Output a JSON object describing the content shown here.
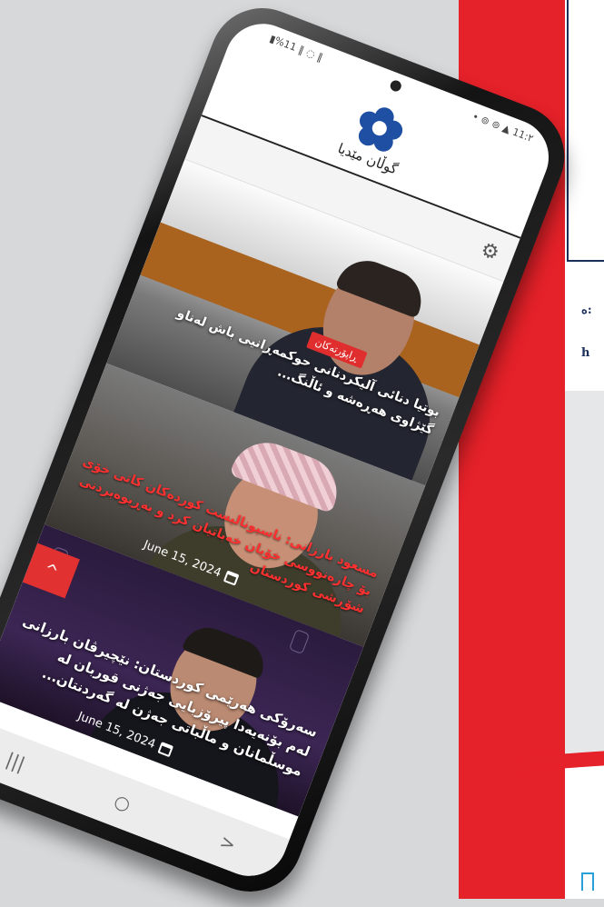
{
  "status_bar": {
    "left": "▮%11 ‖ ◌ ‖",
    "right": "• ⊚ ⊚ ▲ 11:٢"
  },
  "header": {
    "site_title": "گوڵان مێدیا"
  },
  "toolbar": {
    "settings_icon": "gear-icon"
  },
  "articles": [
    {
      "category": "ڕاپۆرتەکان",
      "headline": "بوتیا دنائی آلیکردنانی حوکمەڕانیی باش لەناو گێژاوی هەڕەشە و ئاڵنگ...",
      "date": ""
    },
    {
      "category": "",
      "headline": "مسعود بارزانی: ناسیونالیست کوردەکان کاتی خۆی بۆ چارەنووسی خۆیان خەباتیان کرد و بەڕیوەبردنی شۆڕشی کوردستان",
      "date": "June 15, 2024"
    },
    {
      "category": "",
      "headline": "سەرۆکی هەرێمی کوردستان: نێچیرڤان بارزانی لەم بۆنەیەدا پیرۆزبایی جەژنی قوربان لە موسڵمانان و ماڵباتی جەژن لە گەردنتان...",
      "date": "June 15, 2024"
    }
  ],
  "scroll_top_label": "^",
  "nav": {
    "recent": "|||",
    "home": "○",
    "back": ">"
  },
  "background": {
    "side_text_1": "ە:",
    "side_text_2": "h"
  },
  "colors": {
    "brand_blue": "#1e4fa3",
    "accent_red": "#e02e2e",
    "poster_red": "#e52129"
  }
}
